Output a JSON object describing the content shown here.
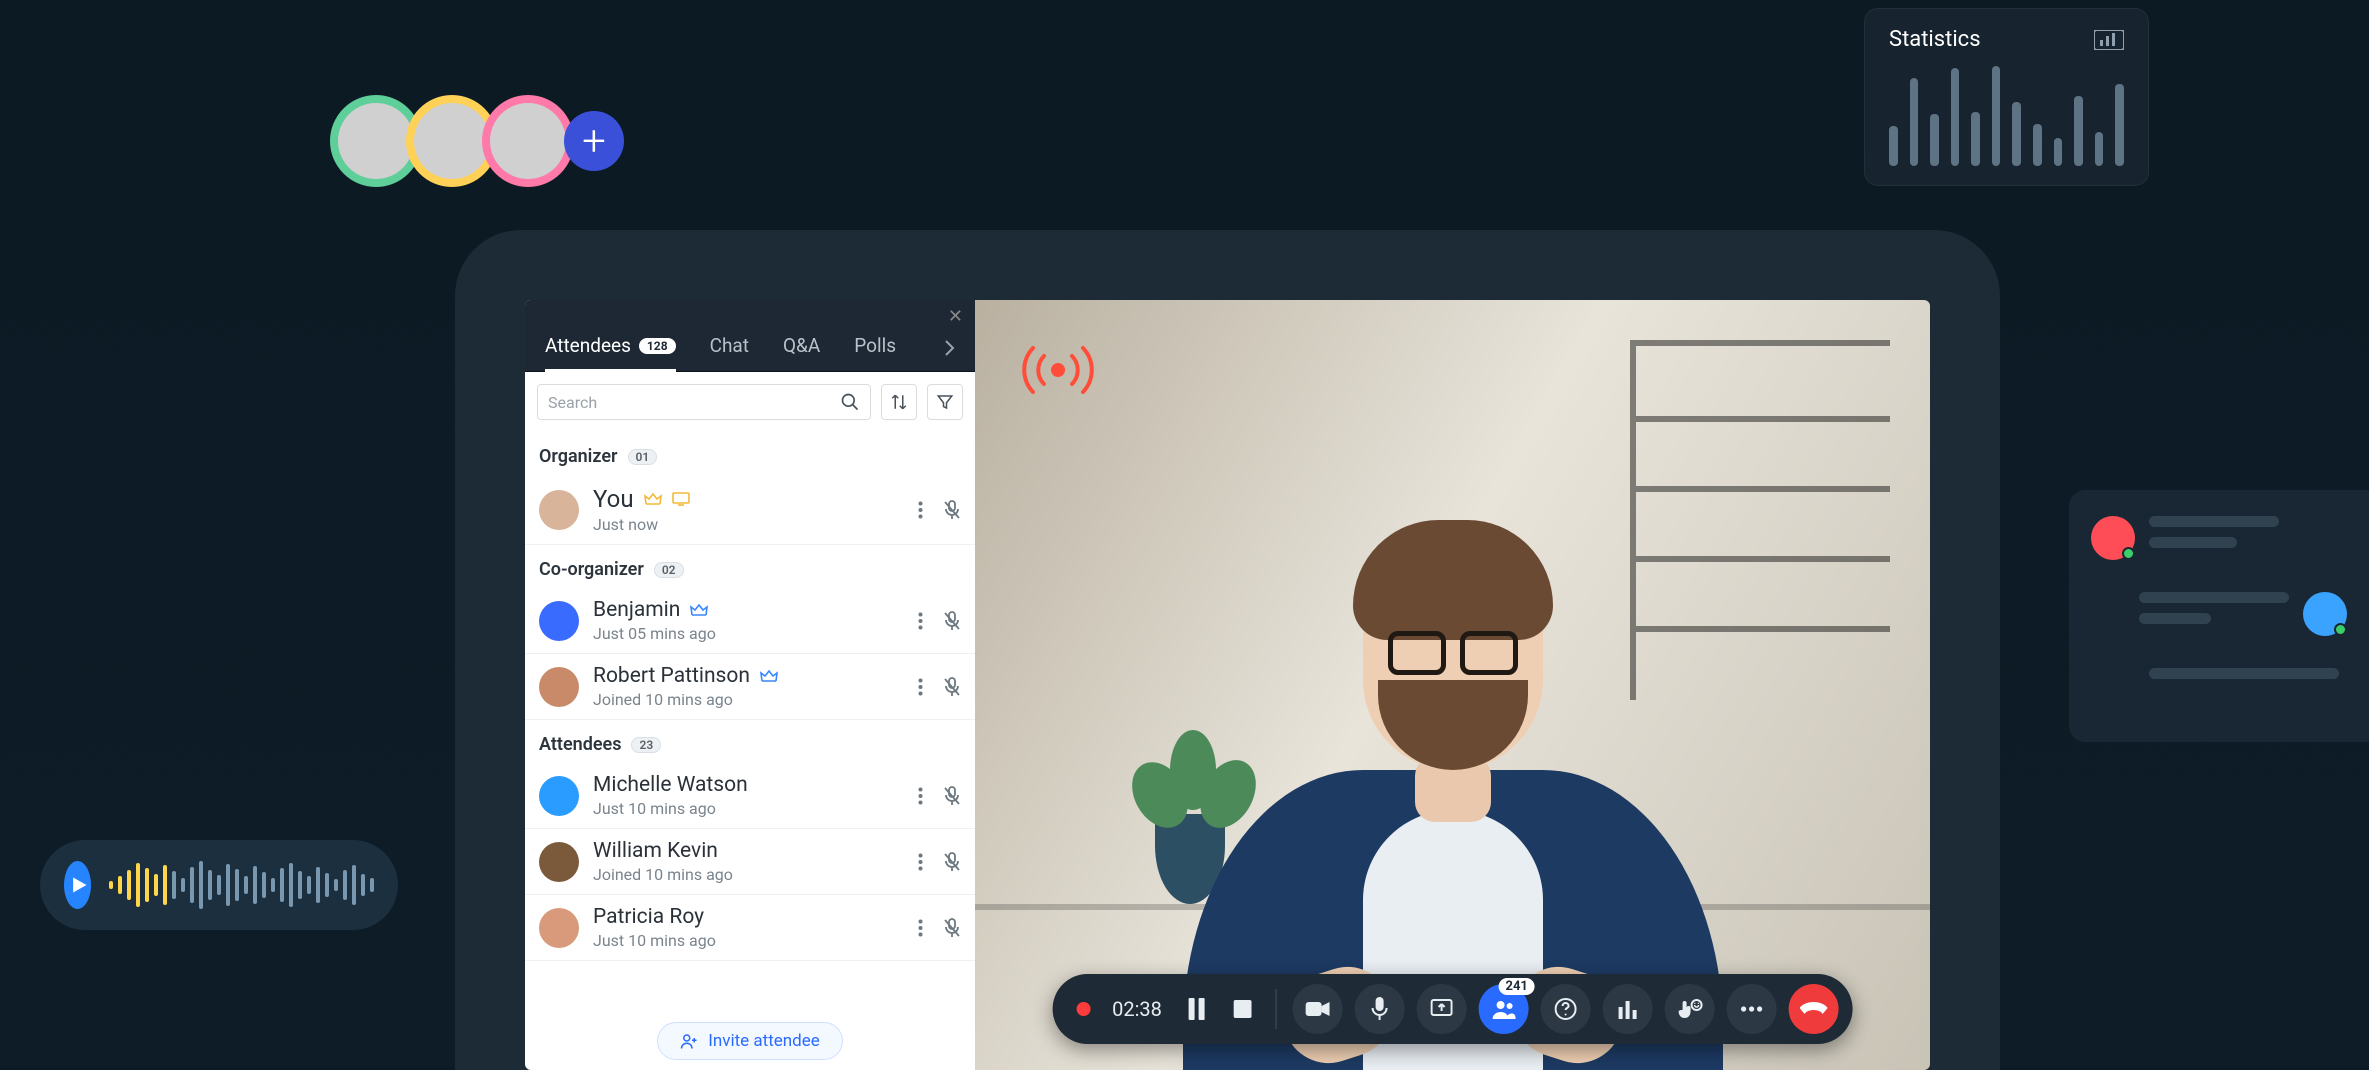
{
  "avatar_stack": {
    "colors": [
      "#5fcf9a",
      "#ffd257",
      "#ff7aa9"
    ],
    "add_label": "+"
  },
  "statistics": {
    "title": "Statistics",
    "bars": [
      40,
      88,
      52,
      98,
      54,
      100,
      64,
      42,
      28,
      70,
      34,
      82
    ]
  },
  "chat_preview": {
    "rows": [
      {
        "side": "left",
        "avatar_color": "#ff4d57",
        "line_widths": [
          130,
          88
        ]
      },
      {
        "side": "right",
        "avatar_color": "#3aa3ff",
        "line_widths": [
          150,
          72
        ]
      },
      {
        "side": "left",
        "avatar_color": "transparent",
        "line_widths": [
          190
        ]
      }
    ]
  },
  "audio_pill": {
    "play_icon": "play-icon"
  },
  "panel": {
    "tabs": {
      "items": [
        {
          "label": "Attendees",
          "count": "128",
          "active": true
        },
        {
          "label": "Chat"
        },
        {
          "label": "Q&A"
        },
        {
          "label": "Polls"
        }
      ]
    },
    "search_placeholder": "Search",
    "sections": [
      {
        "title": "Organizer",
        "count": "01",
        "people": [
          {
            "name": "You",
            "sub": "Just now",
            "crown": "gold",
            "screen": true,
            "big": true
          }
        ]
      },
      {
        "title": "Co-organizer",
        "count": "02",
        "people": [
          {
            "name": "Benjamin",
            "sub": "Just 05 mins ago",
            "crown": "blue"
          },
          {
            "name": "Robert Pattinson",
            "sub": "Joined 10 mins ago",
            "crown": "blue"
          }
        ]
      },
      {
        "title": "Attendees",
        "count": "23",
        "people": [
          {
            "name": "Michelle Watson",
            "sub": "Just 10 mins ago"
          },
          {
            "name": "William Kevin",
            "sub": "Joined 10 mins ago"
          },
          {
            "name": "Patricia Roy",
            "sub": "Just 10 mins ago"
          }
        ]
      }
    ],
    "invite_label": "Invite attendee"
  },
  "controls": {
    "timer": "02:38",
    "participants_badge": "241"
  }
}
